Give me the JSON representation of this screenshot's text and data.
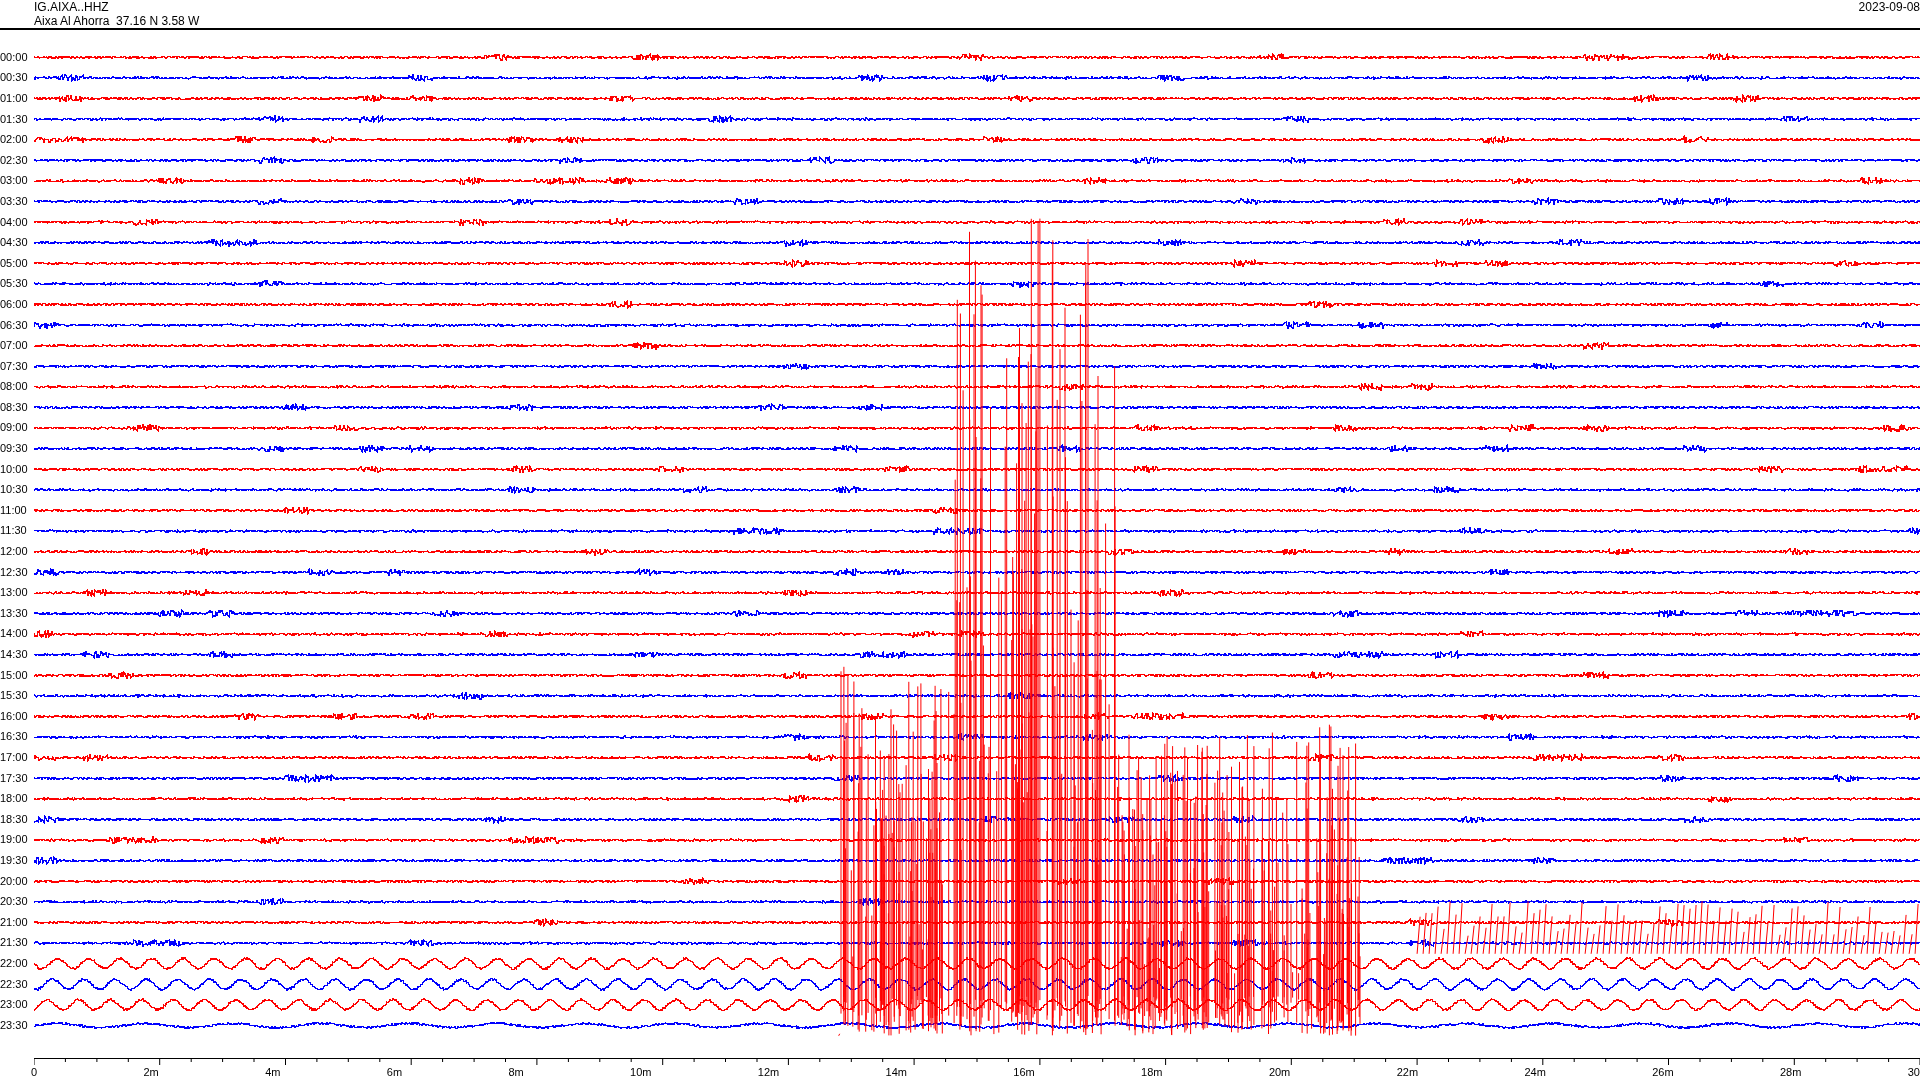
{
  "header": {
    "station": "IG.AIXA..HHZ",
    "location": "Aixa Al Ahorra  37.16 N 3.58 W",
    "date": "2023-09-08"
  },
  "rows": [
    {
      "label": "00:00",
      "color": "#ff0000"
    },
    {
      "label": "00:30",
      "color": "#0000ff"
    },
    {
      "label": "01:00",
      "color": "#ff0000"
    },
    {
      "label": "01:30",
      "color": "#0000ff"
    },
    {
      "label": "02:00",
      "color": "#ff0000"
    },
    {
      "label": "02:30",
      "color": "#0000ff"
    },
    {
      "label": "03:00",
      "color": "#ff0000"
    },
    {
      "label": "03:30",
      "color": "#0000ff"
    },
    {
      "label": "04:00",
      "color": "#ff0000"
    },
    {
      "label": "04:30",
      "color": "#0000ff"
    },
    {
      "label": "05:00",
      "color": "#ff0000"
    },
    {
      "label": "05:30",
      "color": "#0000ff"
    },
    {
      "label": "06:00",
      "color": "#ff0000"
    },
    {
      "label": "06:30",
      "color": "#0000ff"
    },
    {
      "label": "07:00",
      "color": "#ff0000"
    },
    {
      "label": "07:30",
      "color": "#0000ff"
    },
    {
      "label": "08:00",
      "color": "#ff0000"
    },
    {
      "label": "08:30",
      "color": "#0000ff"
    },
    {
      "label": "09:00",
      "color": "#ff0000"
    },
    {
      "label": "09:30",
      "color": "#0000ff"
    },
    {
      "label": "10:00",
      "color": "#ff0000"
    },
    {
      "label": "10:30",
      "color": "#0000ff"
    },
    {
      "label": "11:00",
      "color": "#ff0000"
    },
    {
      "label": "11:30",
      "color": "#0000ff"
    },
    {
      "label": "12:00",
      "color": "#ff0000"
    },
    {
      "label": "12:30",
      "color": "#0000ff"
    },
    {
      "label": "13:00",
      "color": "#ff0000"
    },
    {
      "label": "13:30",
      "color": "#0000ff"
    },
    {
      "label": "14:00",
      "color": "#ff0000"
    },
    {
      "label": "14:30",
      "color": "#0000ff"
    },
    {
      "label": "15:00",
      "color": "#ff0000"
    },
    {
      "label": "15:30",
      "color": "#0000ff"
    },
    {
      "label": "16:00",
      "color": "#ff0000"
    },
    {
      "label": "16:30",
      "color": "#0000ff"
    },
    {
      "label": "17:00",
      "color": "#ff0000"
    },
    {
      "label": "17:30",
      "color": "#0000ff"
    },
    {
      "label": "18:00",
      "color": "#ff0000"
    },
    {
      "label": "18:30",
      "color": "#0000ff"
    },
    {
      "label": "19:00",
      "color": "#ff0000"
    },
    {
      "label": "19:30",
      "color": "#0000ff"
    },
    {
      "label": "20:00",
      "color": "#ff0000"
    },
    {
      "label": "20:30",
      "color": "#0000ff"
    },
    {
      "label": "21:00",
      "color": "#ff0000"
    },
    {
      "label": "21:30",
      "color": "#0000ff"
    },
    {
      "label": "22:00",
      "color": "#ff0000"
    },
    {
      "label": "22:30",
      "color": "#0000ff"
    },
    {
      "label": "23:00",
      "color": "#ff0000"
    },
    {
      "label": "23:30",
      "color": "#0000ff"
    }
  ],
  "x_axis": {
    "ticks": [
      "0",
      "2m",
      "4m",
      "6m",
      "8m",
      "10m",
      "12m",
      "14m",
      "16m",
      "18m",
      "20m",
      "22m",
      "24m",
      "26m",
      "28m",
      "30"
    ]
  }
}
